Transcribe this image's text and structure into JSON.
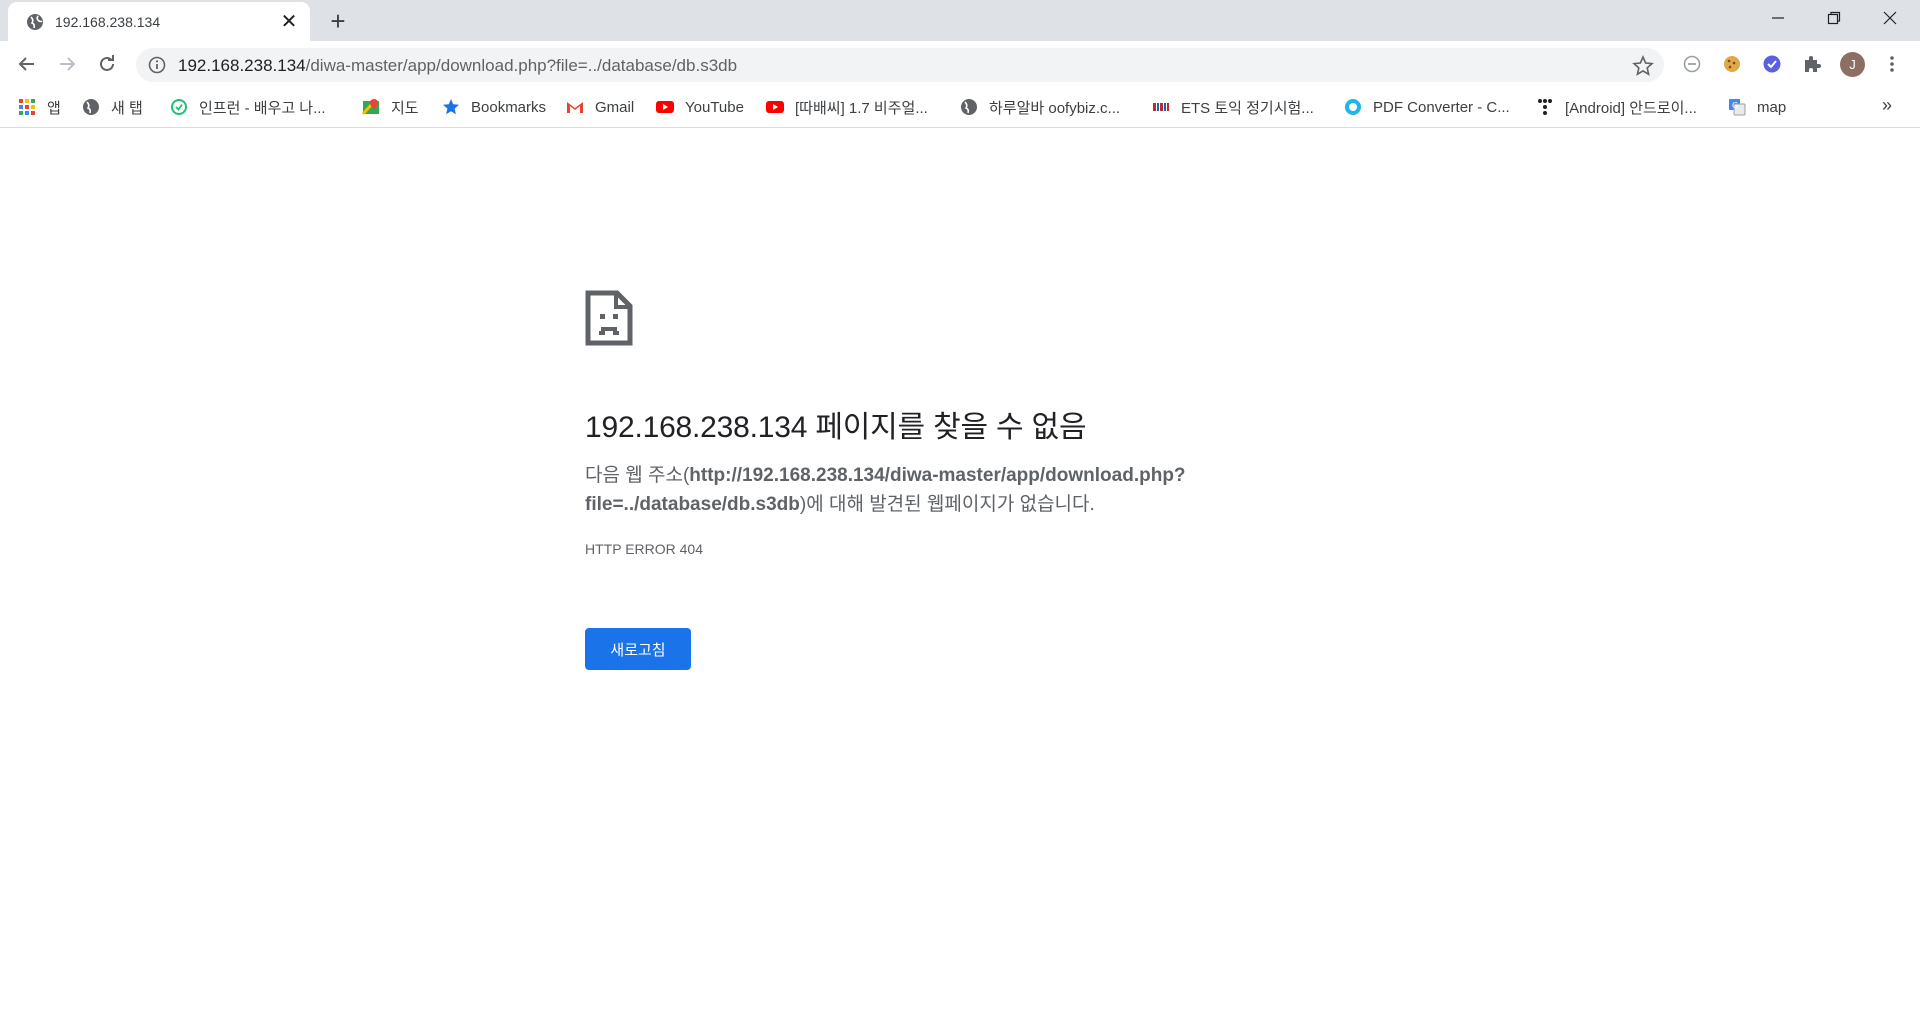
{
  "tab": {
    "title": "192.168.238.134",
    "close": "✕",
    "new": "+"
  },
  "address": {
    "host": "192.168.238.134",
    "path": "/diwa-master/app/download.php?file=../database/db.s3db"
  },
  "profile": {
    "initial": "J"
  },
  "bookmarks": [
    {
      "label": "앱",
      "icon": "apps-grid-icon"
    },
    {
      "label": "새 탭",
      "icon": "globe-icon"
    },
    {
      "label": "인프런 - 배우고 나...",
      "icon": "inflearn-icon"
    },
    {
      "label": "지도",
      "icon": "maps-icon"
    },
    {
      "label": "Bookmarks",
      "icon": "star-icon"
    },
    {
      "label": "Gmail",
      "icon": "gmail-icon"
    },
    {
      "label": "YouTube",
      "icon": "youtube-icon"
    },
    {
      "label": "[따배씨] 1.7 비주얼...",
      "icon": "youtube-icon"
    },
    {
      "label": "하루알바 oofybiz.c...",
      "icon": "globe-icon"
    },
    {
      "label": "ETS 토익 정기시험...",
      "icon": "ets-icon"
    },
    {
      "label": "PDF Converter - C...",
      "icon": "pdf-converter-icon"
    },
    {
      "label": "[Android] 안드로이...",
      "icon": "tistory-icon"
    },
    {
      "label": "map",
      "icon": "translate-icon"
    }
  ],
  "bookmarks_more": "»",
  "error": {
    "headline": "192.168.238.134 페이지를 찾을 수 없음",
    "desc_prefix": "다음 웹 주소(",
    "desc_url": "http://192.168.238.134/diwa-master/app/download.php?file=../database/db.s3db",
    "desc_suffix": ")에 대해 발견된 웹페이지가 없습니다.",
    "code": "HTTP ERROR 404",
    "reload_label": "새로고침"
  },
  "colors": {
    "accent": "#1a73e8",
    "tabstrip": "#dee1e6",
    "omnibox": "#f1f3f4"
  }
}
